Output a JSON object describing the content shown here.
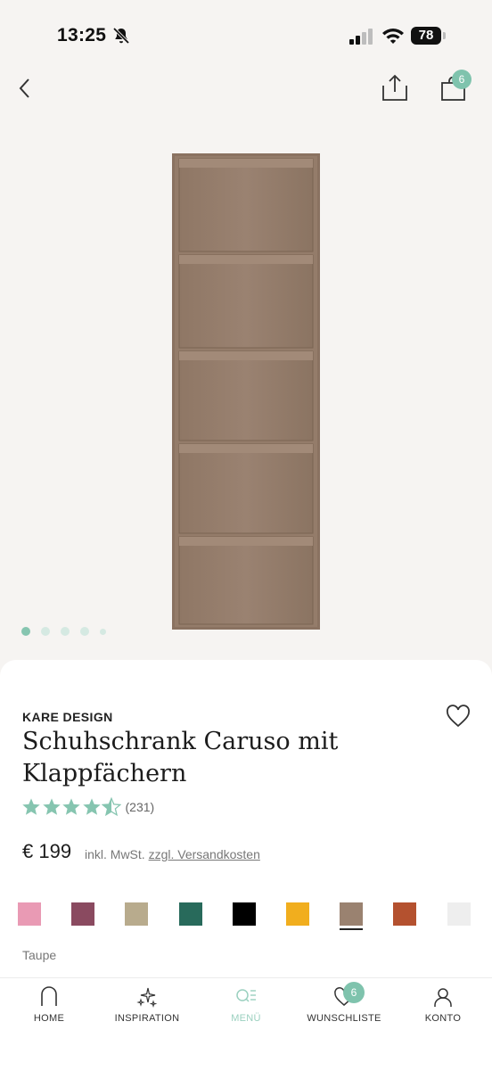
{
  "status_bar": {
    "time": "13:25",
    "battery": "78"
  },
  "header": {
    "cart_count": "6"
  },
  "gallery": {
    "image_count": 5,
    "active_index": 0
  },
  "product": {
    "brand": "KARE DESIGN",
    "title": "Schuhschrank Caruso mit Klappfächern",
    "rating": 4.5,
    "review_count": "(231)",
    "price": "€ 199",
    "tax_note": "inkl. MwSt.",
    "shipping_link": "zzgl. Versandkosten",
    "selected_color_name": "Taupe"
  },
  "colors": [
    {
      "name": "pink",
      "hex": "#e99ab4"
    },
    {
      "name": "mauve",
      "hex": "#8a4a60"
    },
    {
      "name": "beige",
      "hex": "#b8ab8d"
    },
    {
      "name": "green",
      "hex": "#286a5b"
    },
    {
      "name": "black",
      "hex": "#000000"
    },
    {
      "name": "yellow",
      "hex": "#f1ae1e"
    },
    {
      "name": "taupe",
      "hex": "#9a8270",
      "selected": true
    },
    {
      "name": "rust",
      "hex": "#b4512f"
    },
    {
      "name": "white",
      "hex": "#eeeeee"
    }
  ],
  "tabs": [
    {
      "label": "HOME",
      "icon": "home-icon"
    },
    {
      "label": "INSPIRATION",
      "icon": "sparkle-icon"
    },
    {
      "label": "MENÜ",
      "icon": "menu-search-icon",
      "active": true
    },
    {
      "label": "WUNSCHLISTE",
      "icon": "heart-icon",
      "badge": "6"
    },
    {
      "label": "KONTO",
      "icon": "user-icon"
    }
  ],
  "theme": {
    "accent": "#86c5b0",
    "product_color": "#9a8270"
  }
}
